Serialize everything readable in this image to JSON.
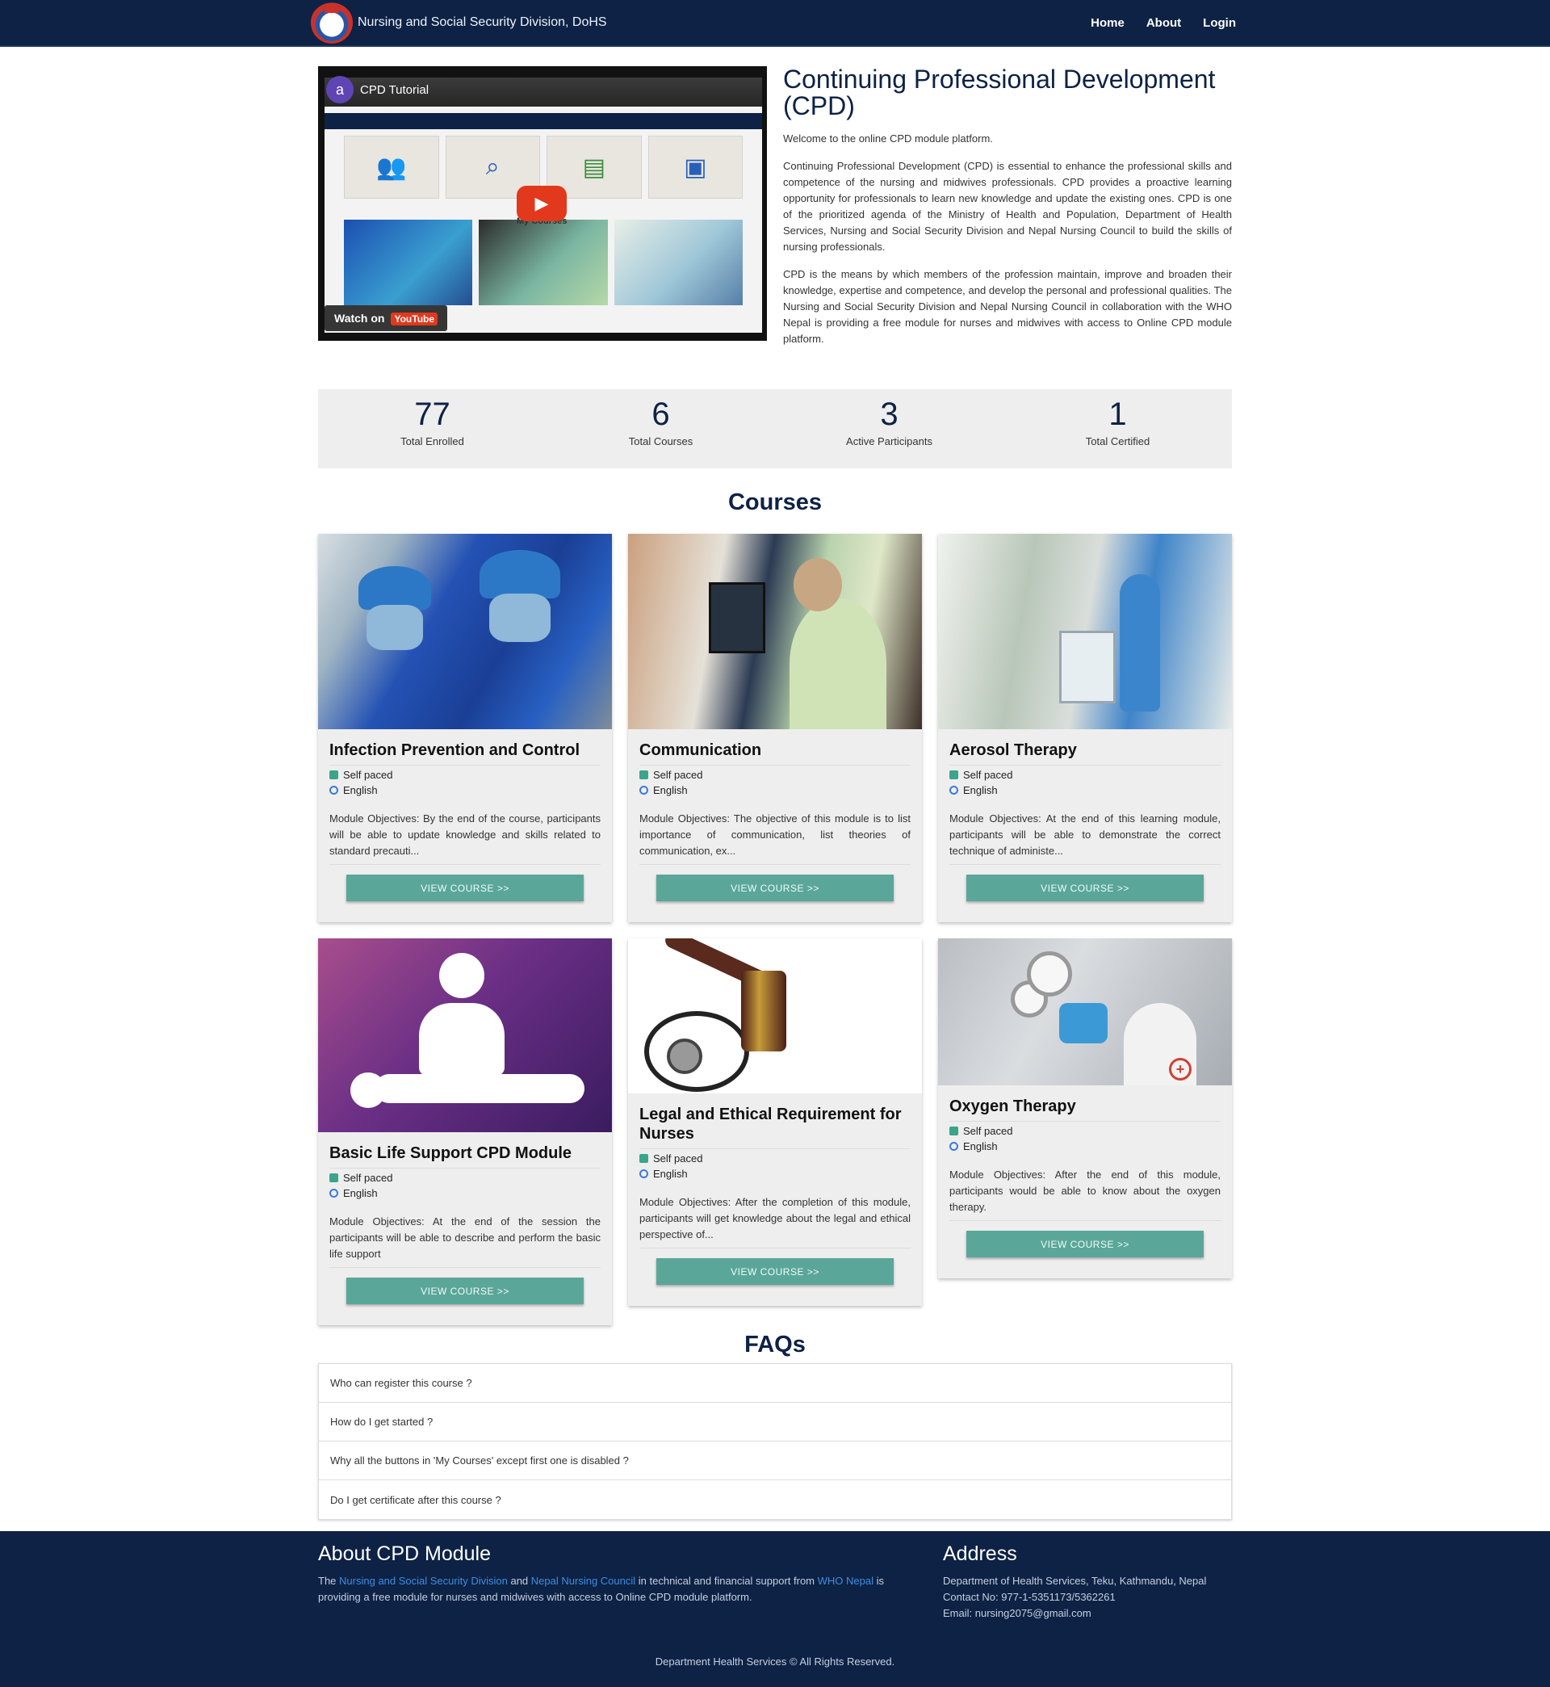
{
  "header": {
    "site_title": "Nursing and Social Security Division, DoHS",
    "nav": [
      {
        "label": "Home"
      },
      {
        "label": "About"
      },
      {
        "label": "Login"
      }
    ]
  },
  "video": {
    "title": "CPD Tutorial",
    "channel_initial": "a",
    "watch_on": "Watch on",
    "watch_brand": "YouTube",
    "inner_label": "My Courses"
  },
  "intro": {
    "heading": "Continuing Professional Development (CPD)",
    "welcome": "Welcome to the online CPD module platform.",
    "paragraph1": "Continuing Professional Development (CPD) is essential to enhance the professional skills and competence of the nursing and midwives professionals. CPD provides a proactive learning opportunity for professionals to learn new knowledge and update the existing ones. CPD is one of the prioritized agenda of the Ministry of Health and Population, Department of Health Services, Nursing and Social Security Division and Nepal Nursing Council to build the skills of nursing professionals.",
    "paragraph2": "CPD is the means by which members of the profession maintain, improve and broaden their knowledge, expertise and competence, and develop the personal and professional qualities. The Nursing and Social Security Division and Nepal Nursing Council in collaboration with the WHO Nepal is providing a free module for nurses and midwives with access to Online CPD module platform."
  },
  "stats": [
    {
      "value": "77",
      "label": "Total Enrolled"
    },
    {
      "value": "6",
      "label": "Total Courses"
    },
    {
      "value": "3",
      "label": "Active Participants"
    },
    {
      "value": "1",
      "label": "Total Certified"
    }
  ],
  "courses_title": "Courses",
  "courses": [
    {
      "title": "Infection Prevention and Control",
      "pace": "Self paced",
      "language": "English",
      "description": "Module Objectives: By the end of the course, participants will be able to update knowledge and skills related to standard precauti...",
      "button": "VIEW COURSE >>"
    },
    {
      "title": "Communication",
      "pace": "Self paced",
      "language": "English",
      "description": "Module Objectives: The objective of this module is to list importance of communication, list theories of communication, ex...",
      "button": "VIEW COURSE >>"
    },
    {
      "title": "Aerosol Therapy",
      "pace": "Self paced",
      "language": "English",
      "description": "Module Objectives: At the end of this learning module, participants will be able to demonstrate the correct technique of administe...",
      "button": "VIEW COURSE >>"
    },
    {
      "title": "Basic Life Support CPD Module",
      "pace": "Self paced",
      "language": "English",
      "description": "Module Objectives: At the end of the session the participants will be able to describe and perform the basic life support",
      "button": "VIEW COURSE >>"
    },
    {
      "title": "Legal and Ethical Requirement for Nurses",
      "pace": "Self paced",
      "language": "English",
      "description": "Module Objectives: After the completion of this module, participants will get knowledge about the legal and ethical perspective of...",
      "button": "VIEW COURSE >>"
    },
    {
      "title": "Oxygen Therapy",
      "pace": "Self paced",
      "language": "English",
      "description": "Module Objectives: After the end of this module, participants would be able to know about the oxygen therapy.",
      "button": "VIEW COURSE >>"
    }
  ],
  "faqs_title": "FAQs",
  "faqs": [
    {
      "question": "Who can register this course ?"
    },
    {
      "question": "How do I get started ?"
    },
    {
      "question": "Why all the buttons in 'My Courses' except first one is disabled ?"
    },
    {
      "question": "Do I get certificate after this course ?"
    }
  ],
  "footer": {
    "about_title": "About CPD Module",
    "about_prefix": "The",
    "link_nssd": "Nursing and Social Security Division",
    "about_and": "and",
    "link_nnc": "Nepal Nursing Council",
    "about_middle": "in technical and financial support from",
    "link_who": "WHO Nepal",
    "about_suffix": "is providing a free module for nurses and midwives with access to Online CPD module platform.",
    "address_title": "Address",
    "address_line": "Department of Health Services, Teku, Kathmandu, Nepal",
    "contact": "Contact No: 977-1-5351173/5362261",
    "email": "Email: nursing2075@gmail.com",
    "copyright": "Department Health Services © All Rights Reserved."
  },
  "colors": {
    "navy": "#0d2245",
    "button_teal": "#5aa79a",
    "card_bg": "#eeeeee",
    "link_blue": "#3d8ee0"
  }
}
